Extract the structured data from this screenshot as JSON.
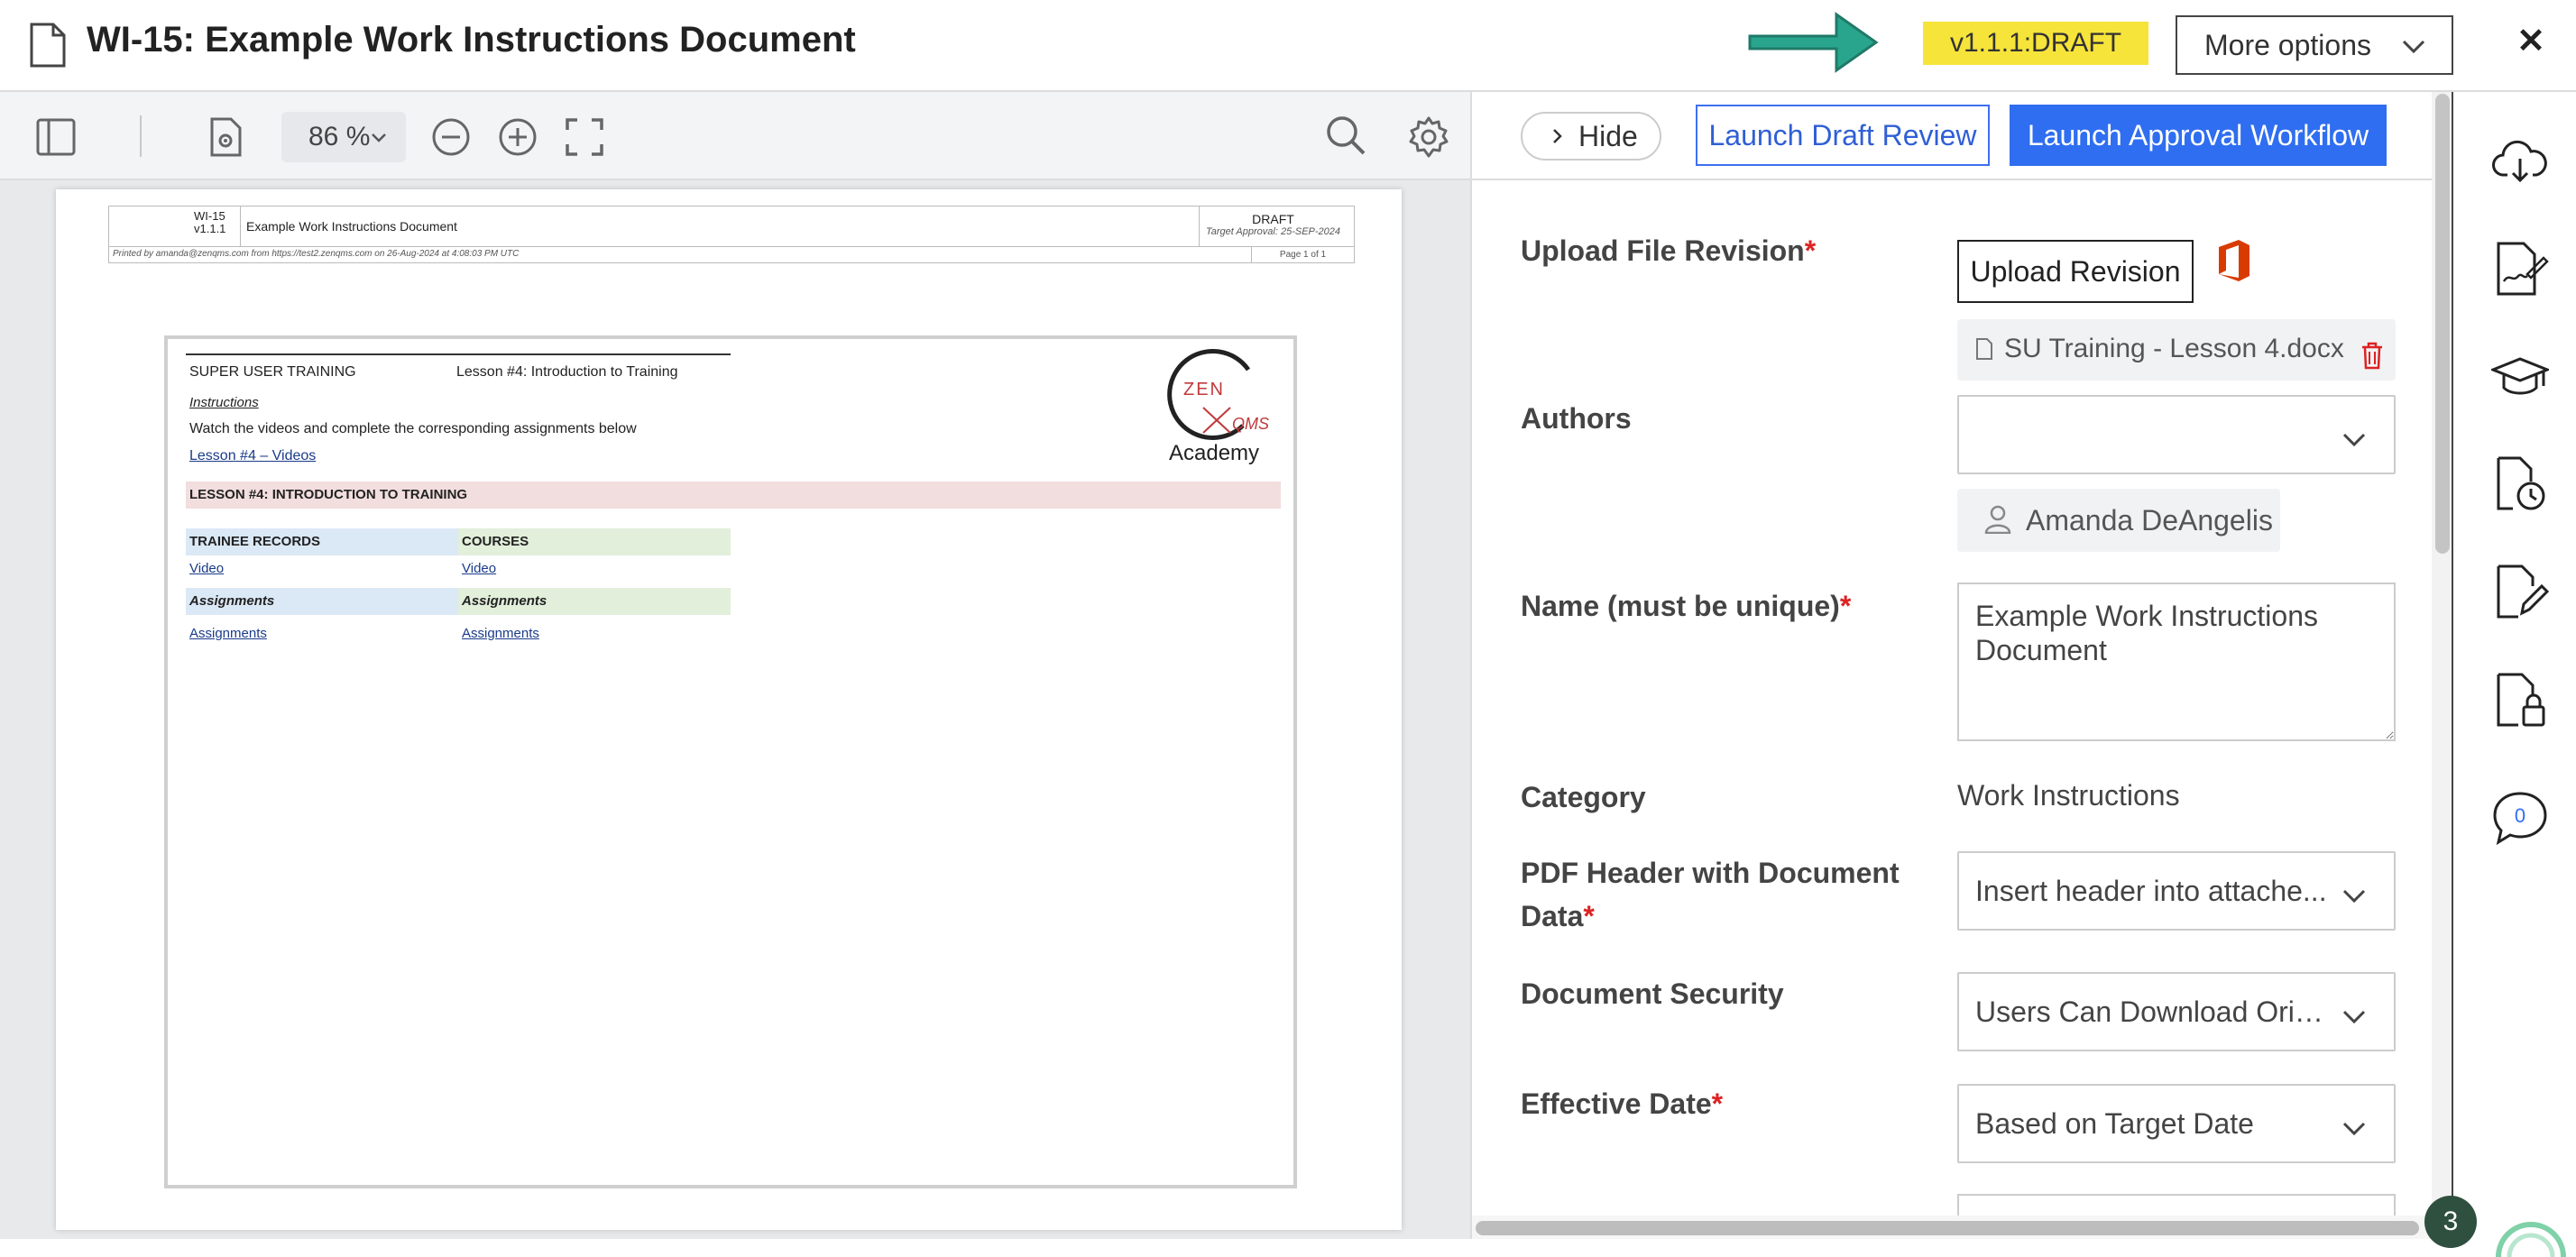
{
  "header": {
    "title": "WI-15: Example Work Instructions Document",
    "version_badge": "v1.1.1:DRAFT",
    "more_options_label": "More options",
    "close_symbol": "✕",
    "arrow_color": "#29a08a",
    "badge_color": "#f7e43a"
  },
  "viewer_toolbar": {
    "zoom_level": "86 %",
    "icons": [
      "sidebar-toggle-icon",
      "document-settings-icon",
      "zoom-out-icon",
      "zoom-in-icon",
      "fullscreen-icon",
      "search-icon",
      "gear-icon"
    ]
  },
  "pdf_page": {
    "header_id": "WI-15",
    "header_version": "v1.1.1",
    "header_title": "Example Work Instructions Document",
    "header_status": "DRAFT",
    "header_target": "Target Approval: 25-SEP-2024",
    "printed_by": "Printed by amanda@zenqms.com from https://test2.zenqms.com on 26-Aug-2024 at 4:08:03 PM UTC",
    "page_number": "Page 1 of 1",
    "content": {
      "super_user": "SUPER USER TRAINING",
      "lesson_title": "Lesson #4: Introduction to Training",
      "instructions_label": "Instructions",
      "instructions_text": "Watch the videos and complete the corresponding assignments below",
      "videos_link": "Lesson #4 – Videos",
      "section_bar": "LESSON #4: INTRODUCTION TO TRAINING",
      "col1_header": "TRAINEE RECORDS",
      "col2_header": "COURSES",
      "col1_video": "Video",
      "col2_video": "Video",
      "col1_assign_header": "Assignments",
      "col2_assign_header": "Assignments",
      "col1_assign_link": "Assignments",
      "col2_assign_link": "Assignments",
      "logo_zen": "ZEN",
      "logo_qms": "QMS",
      "logo_academy": "Academy"
    }
  },
  "panel": {
    "hide_label": "Hide",
    "launch_draft_review": "Launch Draft Review",
    "launch_approval": "Launch Approval Workflow",
    "upload_label": "Upload File Revision",
    "upload_button": "Upload Revision",
    "file_name": "SU Training - Lesson 4.docx",
    "authors_label": "Authors",
    "authors_select_value": "",
    "author_chip": "Amanda DeAngelis",
    "name_label": "Name (must be unique)",
    "name_value": "Example Work Instructions Document",
    "category_label": "Category",
    "category_value": "Work Instructions",
    "pdf_header_label_line1": "PDF Header with Document",
    "pdf_header_label_line2": "Data",
    "pdf_header_value": "Insert header into attache...",
    "security_label": "Document Security",
    "security_value": "Users Can Download Origi...",
    "effective_label": "Effective Date",
    "effective_value": "Based on Target Date",
    "required_mark": "*"
  },
  "rail": {
    "icons": [
      "cloud-download-icon",
      "signature-icon",
      "graduation-cap-icon",
      "document-history-icon",
      "document-edit-icon",
      "document-lock-icon",
      "comment-icon"
    ],
    "comment_count": "0",
    "notification_count": "3"
  }
}
